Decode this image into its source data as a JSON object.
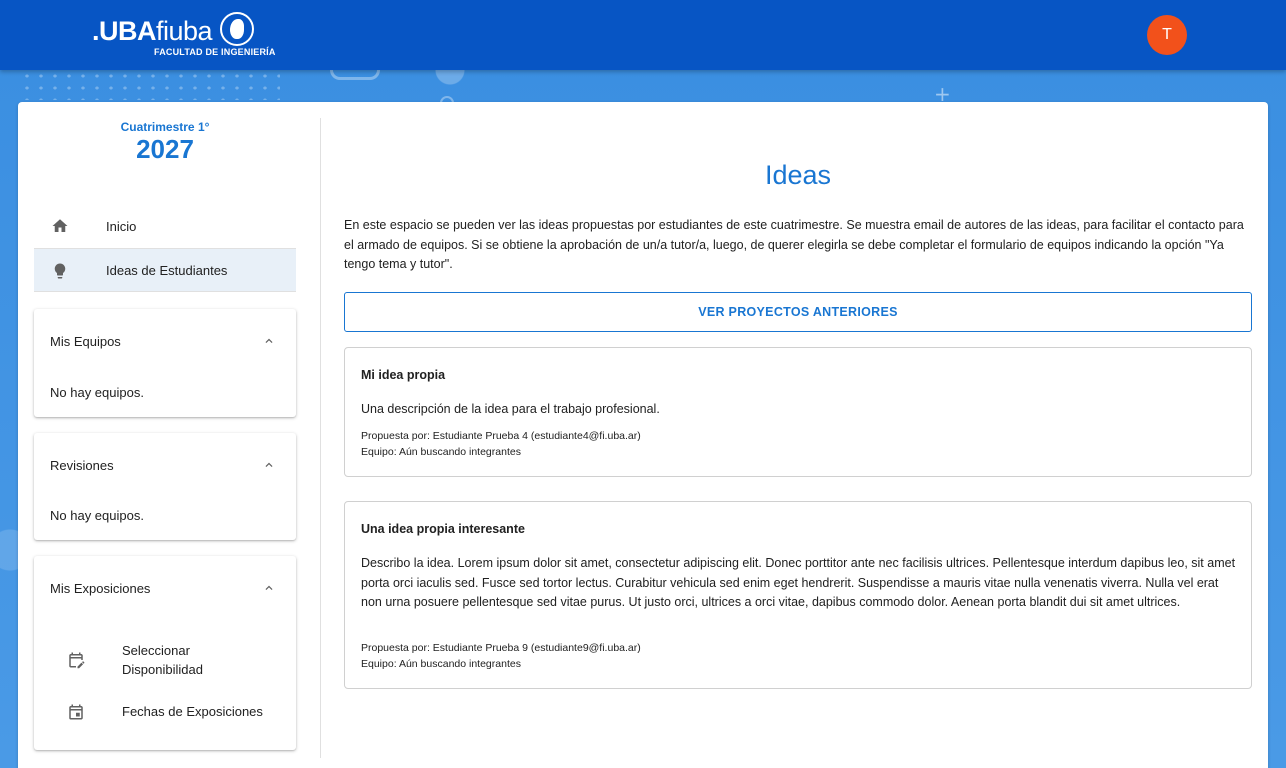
{
  "header": {
    "logo_bold": ".UBA",
    "logo_light": "fiuba",
    "logo_sub": "FACULTAD DE INGENIERÍA",
    "avatar_initial": "T"
  },
  "sidebar": {
    "term_label": "Cuatrimestre 1°",
    "term_year": "2027",
    "nav": [
      {
        "label": "Inicio",
        "icon": "home-icon"
      },
      {
        "label": "Ideas de Estudiantes",
        "icon": "lightbulb-icon",
        "active": true
      }
    ],
    "sections": [
      {
        "title": "Mis Equipos",
        "empty_text": "No hay equipos."
      },
      {
        "title": "Revisiones",
        "empty_text": "No hay equipos."
      },
      {
        "title": "Mis Exposiciones",
        "items": [
          {
            "label": "Seleccionar Disponibilidad",
            "icon": "calendar-edit-icon"
          },
          {
            "label": "Fechas de Exposiciones",
            "icon": "calendar-icon"
          }
        ]
      }
    ]
  },
  "main": {
    "title": "Ideas",
    "intro": "En este espacio se pueden ver las ideas propuestas por estudiantes de este cuatrimestre. Se muestra email de autores de las ideas, para facilitar el contacto para el armado de equipos. Si se obtiene la aprobación de un/a tutor/a, luego, de querer elegirla se debe completar el formulario de equipos indicando la opción \"Ya tengo tema y tutor\".",
    "past_projects_button": "VER PROYECTOS ANTERIORES",
    "ideas": [
      {
        "title": "Mi idea propia",
        "description": "Una descripción de la idea para el trabajo profesional.",
        "proposed_by": "Propuesta por: Estudiante Prueba 4 (estudiante4@fi.uba.ar)",
        "team": "Equipo: Aún buscando integrantes"
      },
      {
        "title": "Una idea propia interesante",
        "description": "Describo la idea. Lorem ipsum dolor sit amet, consectetur adipiscing elit. Donec porttitor ante nec facilisis ultrices. Pellentesque interdum dapibus leo, sit amet porta orci iaculis sed. Fusce sed tortor lectus. Curabitur vehicula sed enim eget hendrerit. Suspendisse a mauris vitae nulla venenatis viverra. Nulla vel erat non urna posuere pellentesque sed vitae purus. Ut justo orci, ultrices a orci vitae, dapibus commodo dolor. Aenean porta blandit dui sit amet ultrices.",
        "proposed_by": "Propuesta por: Estudiante Prueba 9 (estudiante9@fi.uba.ar)",
        "team": "Equipo: Aún buscando integrantes"
      }
    ]
  },
  "colors": {
    "header": "#0755c4",
    "accent": "#1976d2",
    "avatar": "#f2511b",
    "background": "#3a8ee0"
  }
}
